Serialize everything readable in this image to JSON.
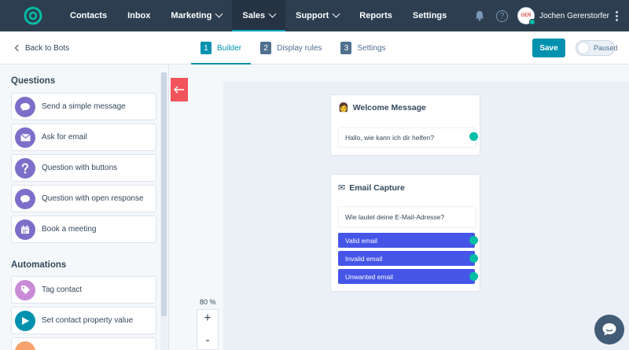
{
  "nav": {
    "items": [
      {
        "label": "Contacts",
        "dropdown": false
      },
      {
        "label": "Inbox",
        "dropdown": false
      },
      {
        "label": "Marketing",
        "dropdown": true
      },
      {
        "label": "Sales",
        "dropdown": true,
        "active": true
      },
      {
        "label": "Support",
        "dropdown": true
      },
      {
        "label": "Reports",
        "dropdown": false
      },
      {
        "label": "Settings",
        "dropdown": false
      }
    ],
    "help_glyph": "?",
    "avatar_text": "GER",
    "user_name": "Jochen Gererstorfer"
  },
  "subheader": {
    "back_label": "Back to Bots",
    "steps": [
      {
        "num": "1",
        "label": "Builder",
        "active": true
      },
      {
        "num": "2",
        "label": "Display rules",
        "active": false
      },
      {
        "num": "3",
        "label": "Settings",
        "active": false
      }
    ],
    "save_label": "Save",
    "toggle_label": "Paused"
  },
  "sidebar": {
    "questions_title": "Questions",
    "questions": [
      {
        "label": "Send a simple message",
        "icon": "chat-bubble-icon",
        "color": "#7c6fc9"
      },
      {
        "label": "Ask for email",
        "icon": "envelope-icon",
        "color": "#7c6fc9"
      },
      {
        "label": "Question with buttons",
        "icon": "question-icon",
        "color": "#7c6fc9"
      },
      {
        "label": "Question with open response",
        "icon": "chat-bubble-icon",
        "color": "#7c6fc9"
      },
      {
        "label": "Book a meeting",
        "icon": "calendar-icon",
        "color": "#7c6fc9"
      }
    ],
    "automations_title": "Automations",
    "automations": [
      {
        "label": "Tag contact",
        "icon": "tag-icon",
        "color": "#c98bd6"
      },
      {
        "label": "Set contact property value",
        "icon": "flag-icon",
        "color": "#0091ae"
      }
    ]
  },
  "canvas": {
    "zoom": "80 %",
    "zoom_in": "+",
    "zoom_out": "-",
    "welcome": {
      "title": "Welcome Message",
      "message": "Hallo, wie kann ich dir helfen?"
    },
    "email": {
      "title": "Email Capture",
      "message": "Wie lautet deine E-Mail-Adresse?",
      "options": [
        "Valid email",
        "Invalid email",
        "Unwanted email"
      ]
    }
  },
  "colors": {
    "nav_bg": "#2d3e50",
    "accent": "#0091ae",
    "option_blue": "#4555e8",
    "port_green": "#00bda5",
    "collapse_red": "#f2545b"
  }
}
